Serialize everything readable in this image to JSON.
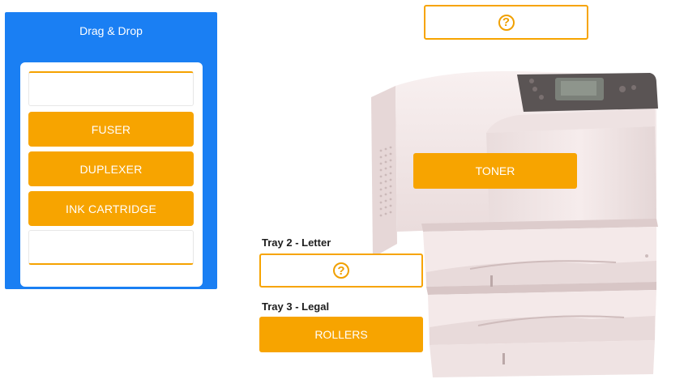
{
  "panel": {
    "title": "Drag & Drop",
    "items": [
      {
        "label": "FUSER"
      },
      {
        "label": "DUPLEXER"
      },
      {
        "label": "INK CARTRIDGE"
      }
    ]
  },
  "targets": {
    "top_marker": "?",
    "tray2_marker": "?",
    "toner_label": "TONER",
    "rollers_label": "ROLLERS"
  },
  "labels": {
    "tray2": "Tray 2 - Letter",
    "tray3": "Tray 3 - Legal"
  },
  "colors": {
    "panel_bg": "#1a7ff3",
    "accent_orange": "#f7a400",
    "printer_body": "#f3e6e6"
  }
}
